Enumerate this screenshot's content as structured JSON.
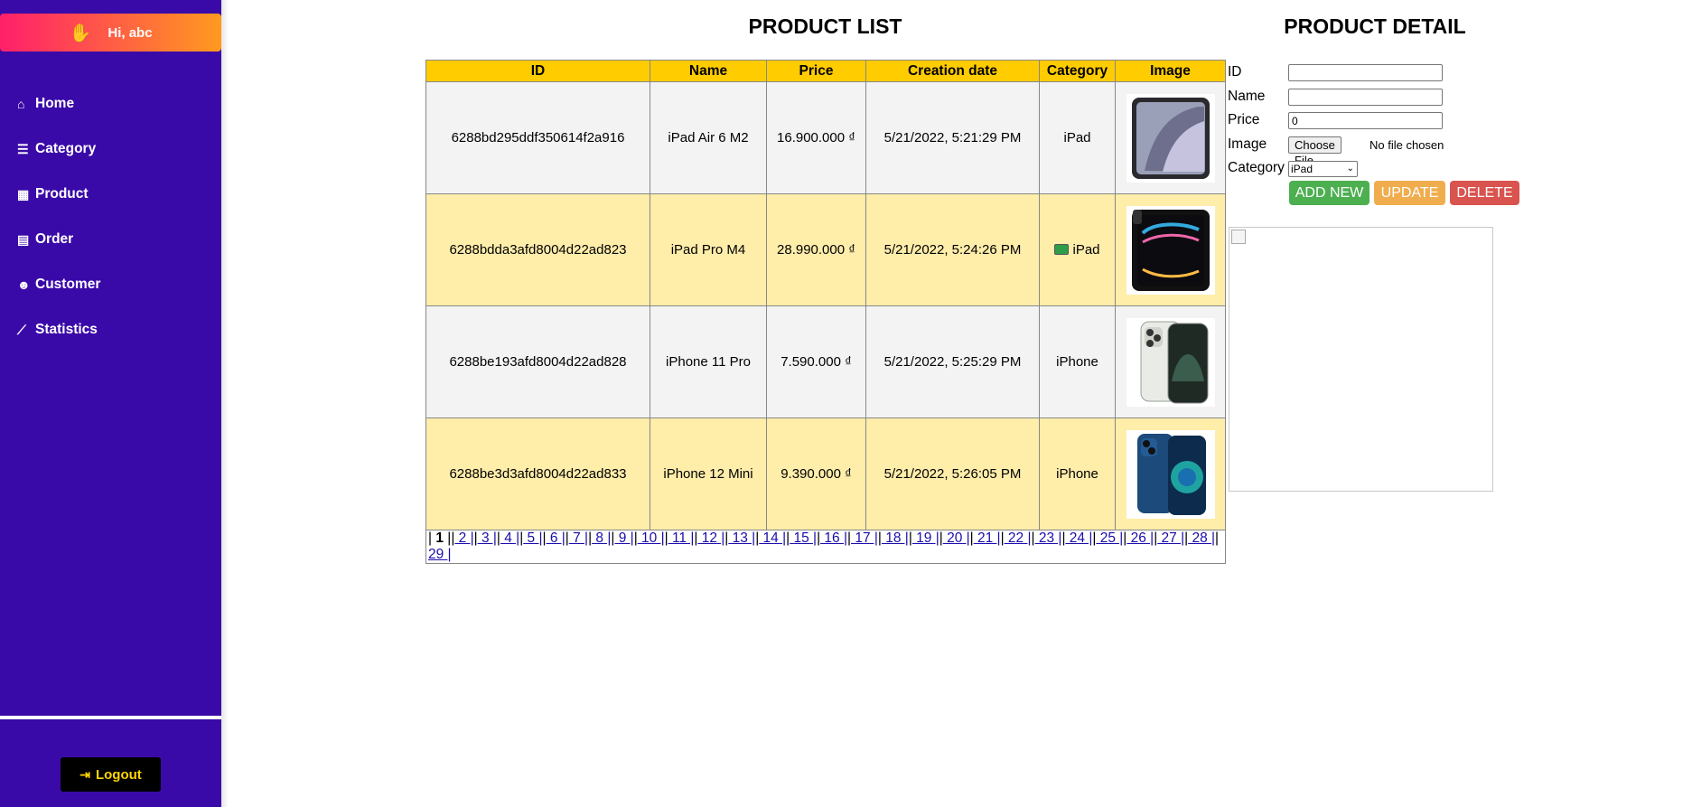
{
  "sidebar": {
    "greeting": "Hi, abc",
    "items": [
      {
        "label": "Home",
        "icon": "home-icon"
      },
      {
        "label": "Category",
        "icon": "list-icon"
      },
      {
        "label": "Product",
        "icon": "gift-icon"
      },
      {
        "label": "Order",
        "icon": "clipboard-icon"
      },
      {
        "label": "Customer",
        "icon": "users-icon"
      },
      {
        "label": "Statistics",
        "icon": "chart-line-icon"
      }
    ],
    "logout": "Logout"
  },
  "product_list": {
    "title": "PRODUCT LIST",
    "headers": [
      "ID",
      "Name",
      "Price",
      "Creation date",
      "Category",
      "Image"
    ],
    "rows": [
      {
        "id": "6288bd295ddf350614f2a916",
        "name": "iPad Air 6 M2",
        "price": "16.900.000 ₫",
        "date": "5/21/2022, 5:21:29 PM",
        "category": "iPad",
        "image": "ipad-air-image"
      },
      {
        "id": "6288bdda3afd8004d22ad823",
        "name": "iPad Pro M4",
        "price": "28.990.000 ₫",
        "date": "5/21/2022, 5:24:26 PM",
        "category": "iPad",
        "image": "ipad-pro-image"
      },
      {
        "id": "6288be193afd8004d22ad828",
        "name": "iPhone 11 Pro",
        "price": "7.590.000 ₫",
        "date": "5/21/2022, 5:25:29 PM",
        "category": "iPhone",
        "image": "iphone-11-pro-image"
      },
      {
        "id": "6288be3d3afd8004d22ad833",
        "name": "iPhone 12 Mini",
        "price": "9.390.000 ₫",
        "date": "5/21/2022, 5:26:05 PM",
        "category": "iPhone",
        "image": "iphone-12-mini-image"
      }
    ],
    "pagination": {
      "current": "1",
      "pages": [
        "2",
        "3",
        "4",
        "5",
        "6",
        "7",
        "8",
        "9",
        "10",
        "11",
        "12",
        "13",
        "14",
        "15",
        "16",
        "17",
        "18",
        "19",
        "20",
        "21",
        "22",
        "23",
        "24",
        "25",
        "26",
        "27",
        "28",
        "29"
      ]
    }
  },
  "product_detail": {
    "title": "PRODUCT DETAIL",
    "id_label": "ID",
    "id_value": "",
    "name_label": "Name",
    "name_value": "",
    "price_label": "Price",
    "price_value": "0",
    "image_label": "Image",
    "file_button": "Choose File",
    "file_status": "No file chosen",
    "category_label": "Category",
    "category_selected": "iPad",
    "add_button": "ADD NEW",
    "update_button": "UPDATE",
    "delete_button": "DELETE"
  },
  "colors": {
    "sidebar_bg": "#3a0aa8",
    "table_header": "#ffcc00",
    "row_alt": "#ffedaa",
    "add": "#4caf50",
    "update": "#f0ad4e",
    "delete": "#d9534f"
  }
}
